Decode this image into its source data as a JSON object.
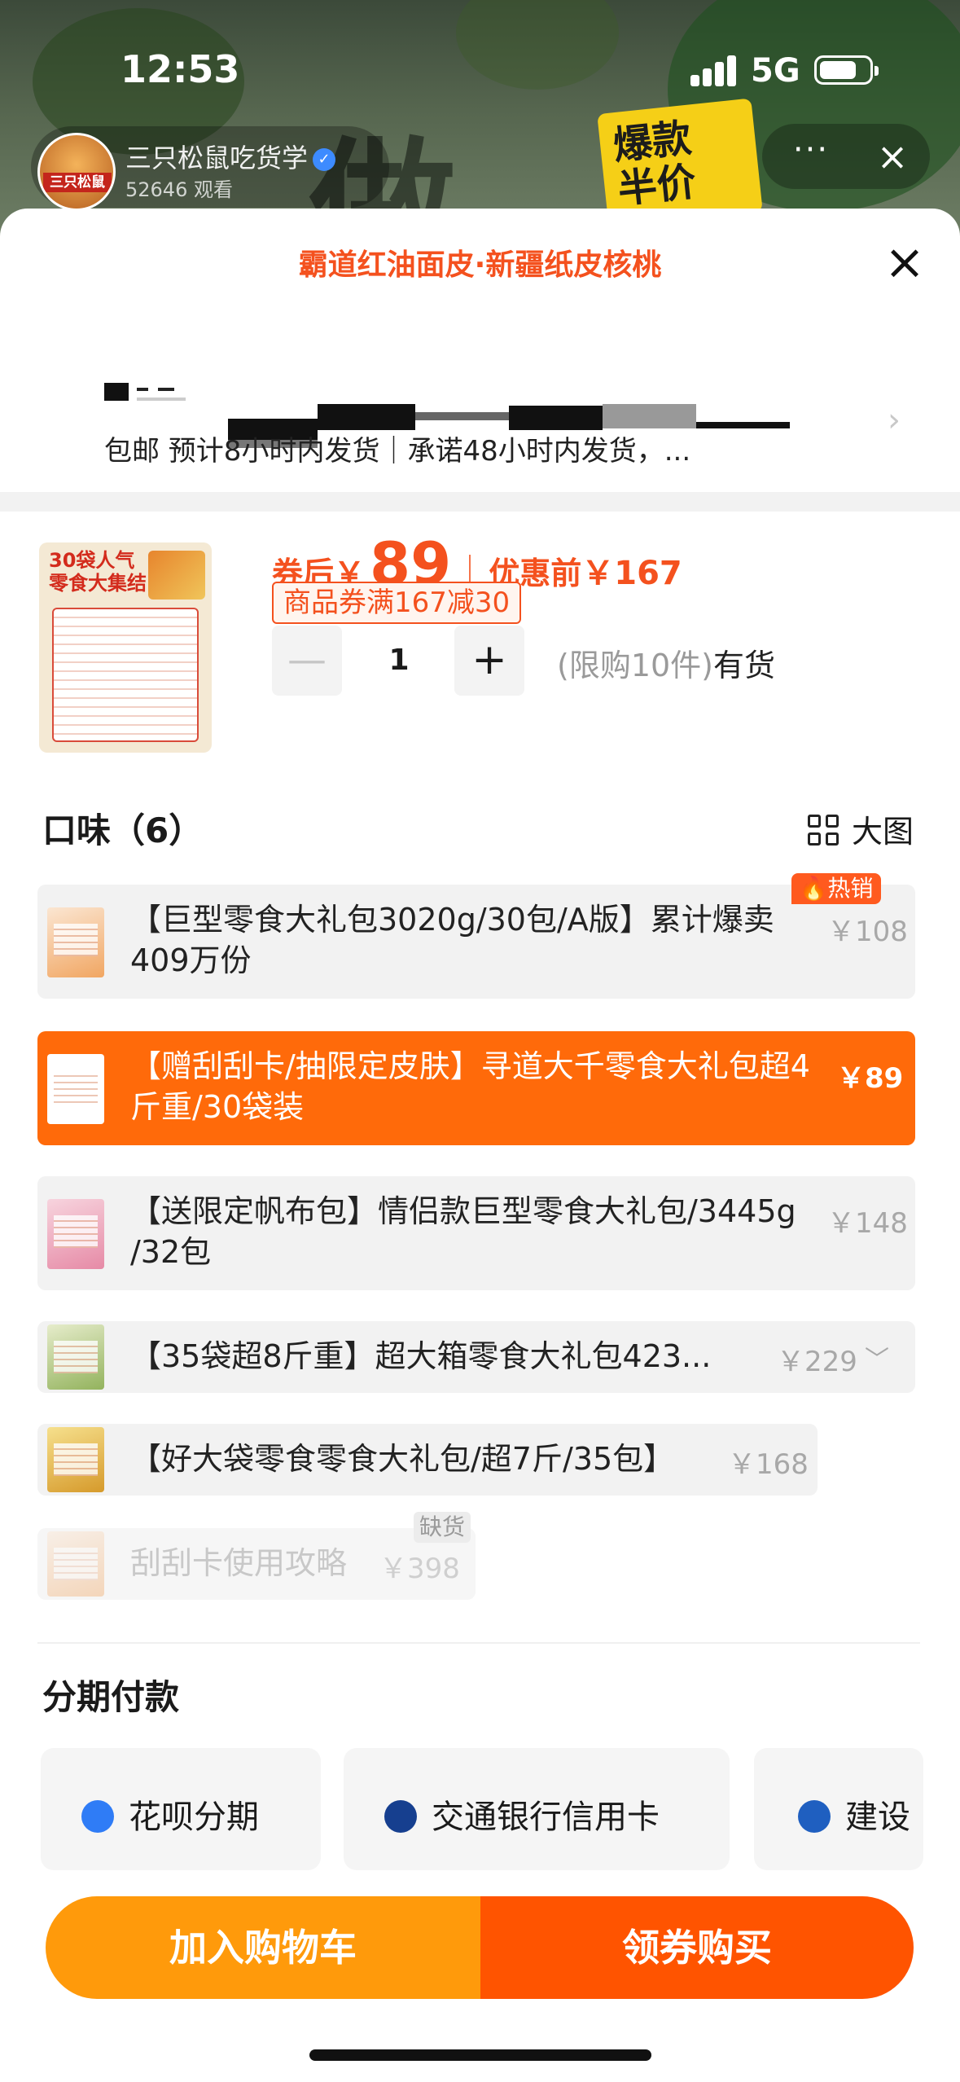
{
  "status_bar": {
    "time": "12:53",
    "network": "5G"
  },
  "live": {
    "host_name": "三只松鼠吃货学",
    "viewers": "52646 观看",
    "host_avatar_tag": "三只松鼠",
    "bg_text": "做",
    "promo_badge": "爆款\n半价"
  },
  "sheet": {
    "title": "霸道红油面皮·新疆纸皮核桃",
    "shipping": "包邮 预计8小时内发货｜承诺48小时内发货，..."
  },
  "product": {
    "thumb_text": "30袋人气\n零食大集结",
    "price_label": "券后￥",
    "price": "89",
    "orig_label": "优惠前",
    "orig_price": "￥167",
    "coupon": "商品券满167减30",
    "quantity": "1",
    "limit": "(限购10件)",
    "stock": "有货"
  },
  "flavor": {
    "title": "口味（6）",
    "big_view": "大图",
    "options": [
      {
        "name": "【巨型零食大礼包3020g/30包/A版】累计爆卖409万份",
        "price": "￥108",
        "badge": "热销",
        "state": "normal"
      },
      {
        "name": "【赠刮刮卡/抽限定皮肤】寻道大千零食大礼包超4斤重/30袋装",
        "price": "￥89",
        "state": "selected"
      },
      {
        "name": "【送限定帆布包】情侣款巨型零食大礼包/3445g /32包",
        "price": "￥148",
        "state": "normal"
      },
      {
        "name": "【35袋超8斤重】超大箱零食大礼包423...",
        "price": "￥229",
        "state": "normal"
      },
      {
        "name": "【好大袋零食零食大礼包/超7斤/35包】",
        "price": "￥168",
        "state": "normal"
      },
      {
        "name": "刮刮卡使用攻略",
        "price": "￥398",
        "badge": "缺货",
        "state": "disabled"
      }
    ]
  },
  "installment": {
    "title": "分期付款",
    "options": [
      {
        "label": "花呗分期",
        "icon": "huabei-icon",
        "color": "#3b7cff"
      },
      {
        "label": "交通银行信用卡",
        "icon": "bocom-icon",
        "color": "#163f8f"
      },
      {
        "label": "建设",
        "icon": "ccb-icon",
        "color": "#1f5fc0"
      }
    ]
  },
  "buttons": {
    "add_cart": "加入购物车",
    "buy": "领券购买"
  },
  "colors": {
    "accent": "#ff5400",
    "cart": "#ff9a0b",
    "price": "#f4511e"
  }
}
